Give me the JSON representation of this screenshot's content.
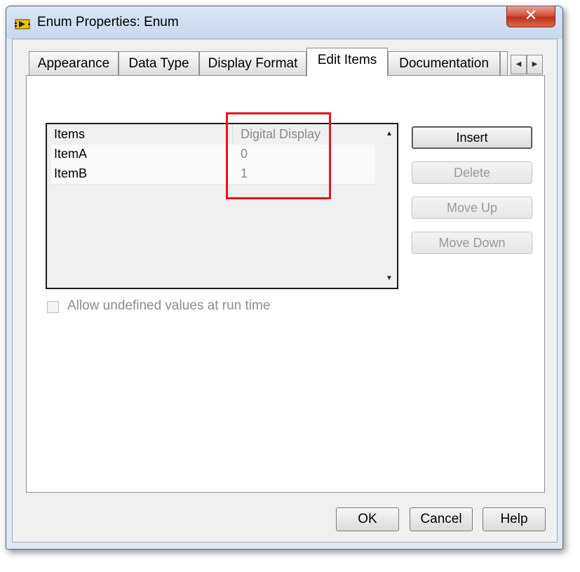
{
  "window": {
    "title": "Enum Properties: Enum",
    "close_label": "✕"
  },
  "tabs": [
    {
      "label": "Appearance",
      "active": false
    },
    {
      "label": "Data Type",
      "active": false
    },
    {
      "label": "Display Format",
      "active": false
    },
    {
      "label": "Edit Items",
      "active": true
    },
    {
      "label": "Documentation",
      "active": false
    }
  ],
  "tab_scroll": {
    "left": "◀",
    "right": "▶"
  },
  "items_table": {
    "headers": {
      "items": "Items",
      "value": "Digital Display"
    },
    "rows": [
      {
        "item": "ItemA",
        "value": "0"
      },
      {
        "item": "ItemB",
        "value": "1"
      }
    ],
    "scroll_up": "▲",
    "scroll_down": "▼"
  },
  "buttons": {
    "insert": "Insert",
    "delete": "Delete",
    "move_up": "Move Up",
    "move_down": "Move Down"
  },
  "checkbox": {
    "label": "Allow undefined values at run time",
    "checked": false
  },
  "footer": {
    "ok": "OK",
    "cancel": "Cancel",
    "help": "Help"
  },
  "colors": {
    "highlight": "#e8121b",
    "close_button": "#c0301b"
  }
}
